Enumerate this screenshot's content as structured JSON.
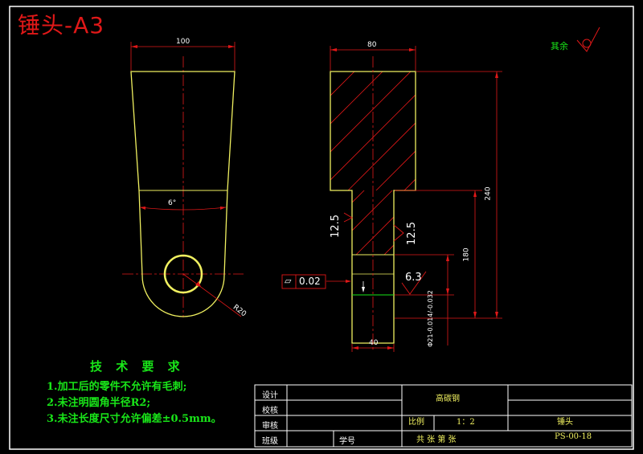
{
  "title": "锤头-A3",
  "roughness_other": "其余",
  "technical_requirements": {
    "heading": "技 术 要 求",
    "items": [
      "1.加工后的零件不允许有毛刺;",
      "2.未注明圆角半径R2;",
      "3.未注长度尺寸允许偏差±0.5mm。"
    ]
  },
  "title_block": {
    "design_label": "设计",
    "check_label": "校核",
    "review_label": "审核",
    "class_label": "班级",
    "student_id_label": "学号",
    "material": "高碳钢",
    "scale_label": "比例",
    "scale_value": "1：2",
    "part_name": "锤头",
    "sheet_text": "共    张    第    张",
    "drawing_number": "PS-00-18"
  },
  "dimensions": {
    "front_width": "100",
    "taper_angle": "6°",
    "radius": "R20",
    "side_width": "80",
    "total_height": "240",
    "lower_height": "180",
    "hole_width": "40",
    "fit_tolerance": "Φ21-0.014/-0.032",
    "flatness_symbol": "▱",
    "flatness_value": "0.02"
  },
  "roughness": {
    "left": "12.5",
    "middle": "12.5",
    "right": "6.3"
  }
}
